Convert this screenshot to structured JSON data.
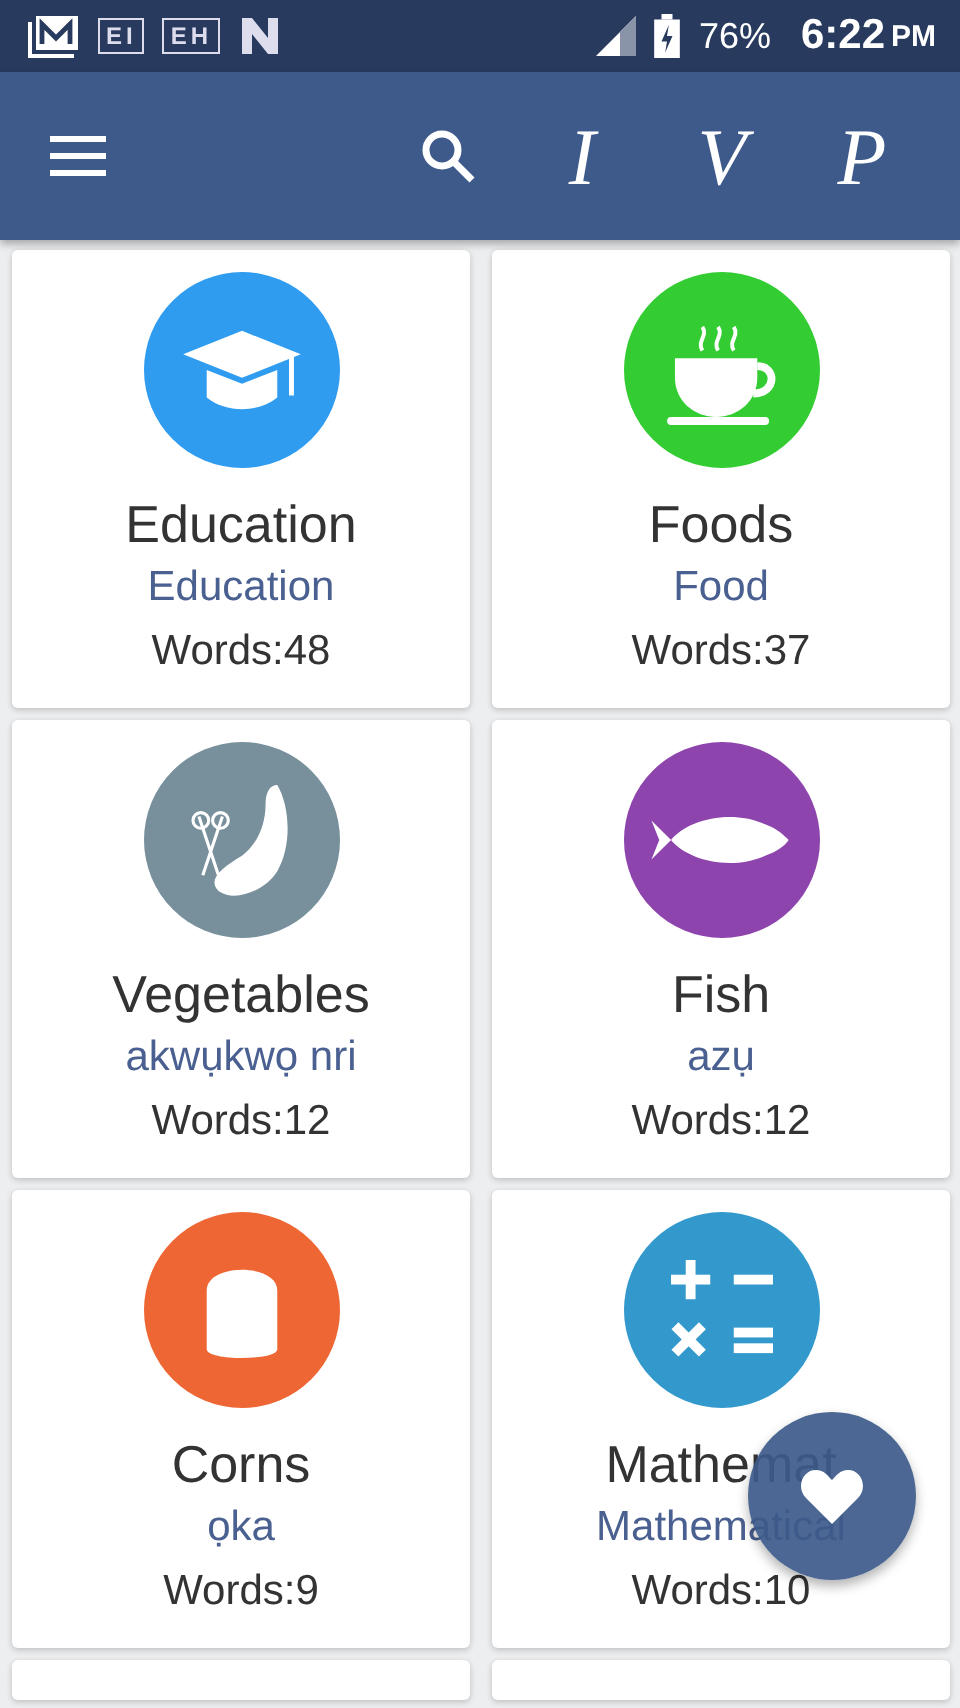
{
  "status_bar": {
    "notifications": [
      "EI",
      "EH"
    ],
    "battery": "76%",
    "time": "6:22",
    "ampm": "PM"
  },
  "toolbar": {
    "actions": [
      "I",
      "V",
      "P"
    ]
  },
  "categories": [
    {
      "kind": "education",
      "title": "Education",
      "subtitle": "Education",
      "count": "Words:48",
      "color": "#2f9cf0"
    },
    {
      "kind": "food",
      "title": "Foods",
      "subtitle": "Food",
      "count": "Words:37",
      "color": "#33cc33"
    },
    {
      "kind": "vegetable",
      "title": "Vegetables",
      "subtitle": "akwụkwọ nri",
      "count": "Words:12",
      "color": "#78909c"
    },
    {
      "kind": "fish",
      "title": "Fish",
      "subtitle": "azụ",
      "count": "Words:12",
      "color": "#8e44ad"
    },
    {
      "kind": "corn",
      "title": "Corns",
      "subtitle": "ọka",
      "count": "Words:9",
      "color": "#ee6633"
    },
    {
      "kind": "math",
      "title": "Mathemat",
      "subtitle": "Mathematical",
      "count": "Words:10",
      "color": "#3399cc"
    }
  ]
}
